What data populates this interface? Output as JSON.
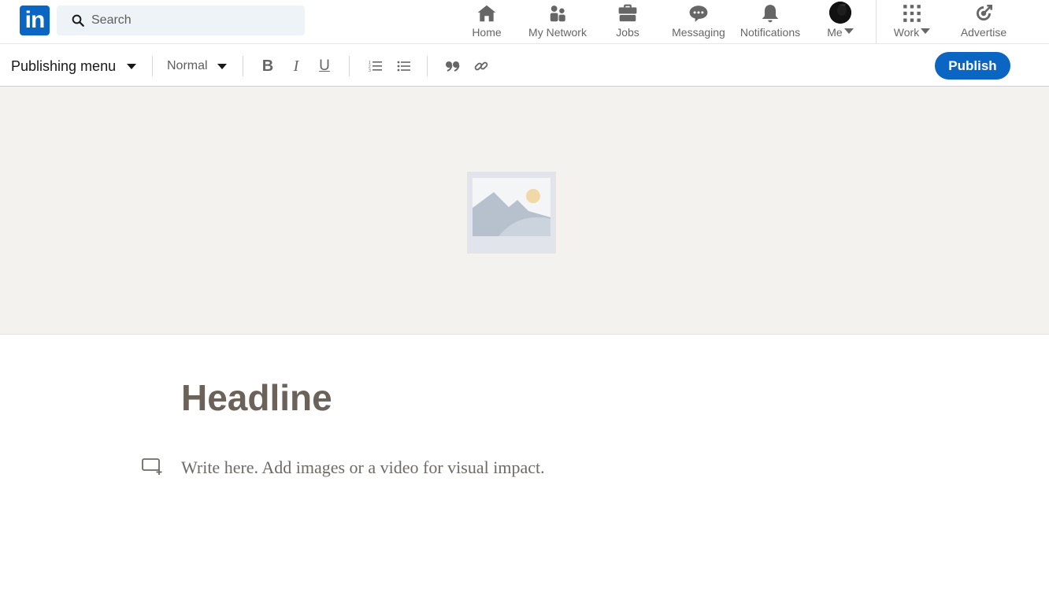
{
  "brand": {
    "logo_text": "in",
    "accent": "#0a66c2"
  },
  "search": {
    "placeholder": "Search",
    "value": ""
  },
  "nav": {
    "items": [
      {
        "label": "Home",
        "icon": "home-icon"
      },
      {
        "label": "My Network",
        "icon": "network-icon"
      },
      {
        "label": "Jobs",
        "icon": "briefcase-icon"
      },
      {
        "label": "Messaging",
        "icon": "messaging-icon"
      },
      {
        "label": "Notifications",
        "icon": "bell-icon"
      },
      {
        "label": "Me",
        "icon": "avatar"
      },
      {
        "label": "Work",
        "icon": "grid-icon"
      },
      {
        "label": "Advertise",
        "icon": "advertise-icon"
      }
    ]
  },
  "toolbar": {
    "publishing_menu": "Publishing menu",
    "text_style": "Normal",
    "bold": "B",
    "italic": "I",
    "underline": "U",
    "publish_label": "Publish"
  },
  "editor": {
    "headline_placeholder": "Headline",
    "body_placeholder": "Write here. Add images or a video for visual impact."
  }
}
